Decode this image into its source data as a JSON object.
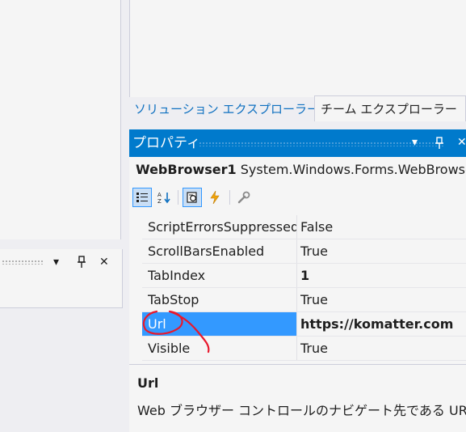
{
  "solution_explorer": {
    "tabs": [
      {
        "label": "ソリューション エクスプローラー"
      },
      {
        "label": "チーム エクスプローラー"
      }
    ]
  },
  "left_panel": {
    "buttons": {
      "dropdown": "▾",
      "pin": "⊥",
      "close": "✕"
    }
  },
  "properties": {
    "title": "プロパティ",
    "title_buttons": {
      "dropdown": "▾",
      "pin": "⊥",
      "close": "✕"
    },
    "object_name": "WebBrowser1",
    "object_type": "System.Windows.Forms.WebBrowser",
    "toolbar": [
      {
        "icon": "categorized-icon"
      },
      {
        "icon": "alphabetical-icon"
      },
      {
        "icon": "properties-icon"
      },
      {
        "icon": "events-icon"
      },
      {
        "icon": "property-pages-icon"
      }
    ],
    "rows": [
      {
        "name": "ScriptErrorsSuppressed",
        "value": "False",
        "bold": false,
        "selected": false
      },
      {
        "name": "ScrollBarsEnabled",
        "value": "True",
        "bold": false,
        "selected": false
      },
      {
        "name": "TabIndex",
        "value": "1",
        "bold": true,
        "selected": false
      },
      {
        "name": "TabStop",
        "value": "True",
        "bold": false,
        "selected": false
      },
      {
        "name": "Url",
        "value": "https://komatter.com",
        "bold": true,
        "selected": true
      },
      {
        "name": "Visible",
        "value": "True",
        "bold": false,
        "selected": false
      }
    ],
    "description": {
      "title": "Url",
      "text": "Web ブラウザー コントロールのナビゲート先である URL を指定します。"
    }
  },
  "colors": {
    "accent": "#007acc",
    "selection": "#3399ff",
    "annotation": "#e8182c",
    "tab_link": "#0e70c0"
  }
}
